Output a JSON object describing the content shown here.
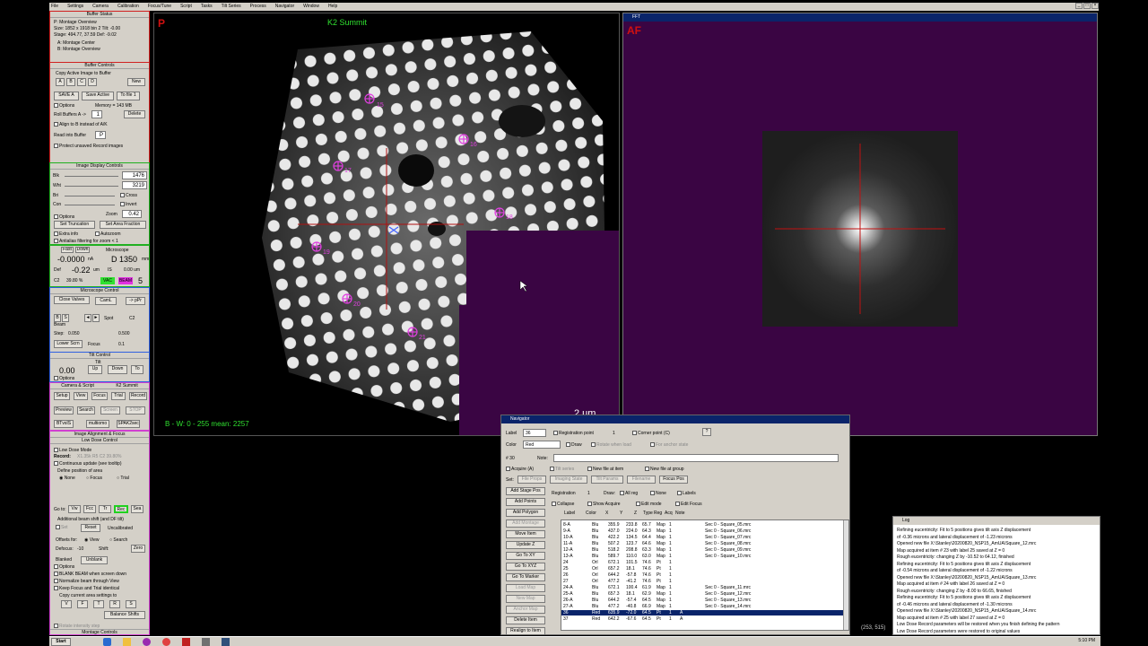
{
  "menu": [
    "File",
    "Settings",
    "Camera",
    "Calibration",
    "Focus/Tune",
    "Script",
    "Tasks",
    "Tilt Series",
    "Process",
    "Navigator",
    "Window",
    "Help"
  ],
  "buffer_status": {
    "title": "Buffer Status",
    "lines": [
      "P: Montage Overview",
      "Size: 1852 x 1918  bin 2    Tilt: -0.00",
      "Stage: 494.77, 37.59      Def: -9.02",
      "A: Montage Center",
      "B: Montage Overview"
    ]
  },
  "buffer_controls": {
    "title": "Buffer Controls",
    "copy_label": "Copy Active Image to Buffer",
    "buffers": [
      "A",
      "B",
      "C",
      "D"
    ],
    "new_label": "New",
    "save_a": "SAVE A",
    "save_active": "Save Active",
    "to_file": "To file 1",
    "options": "Options",
    "memory": "Memory = 143 MB",
    "roll_label": "Roll Buffers A ->",
    "roll_value": "1",
    "delete": "Delete",
    "align": "Align to B instead of A/K",
    "read_label": "Read into Buffer",
    "read_value": "P",
    "protect": "Protect unsaved Record images"
  },
  "image_display": {
    "title": "Image Display Controls",
    "blk_label": "Blk",
    "blk": "1476",
    "wht_label": "Wht",
    "wht": "3219",
    "bri": "Bri",
    "con": "Con",
    "cross": "Cross",
    "invert": "Invert",
    "zoom_label": "Zoom",
    "zoom": "0.42",
    "options": "Options",
    "set_truncation": "Set Truncation",
    "set_area_fraction": "Set Area Fraction",
    "extra_info": "Extra info",
    "autozoom": "Autozoom",
    "antialias": "Antialias filtering for zoom < 1"
  },
  "microscope": {
    "tabs": [
      "Fast",
      "Down"
    ],
    "title": "Microscope",
    "current": "-0.0000",
    "current_unit": "nA",
    "mag": "D  1350",
    "mag_unit": "mm",
    "def_label": "Def",
    "def": "-0.22",
    "def_unit": "um",
    "is_label": "IS",
    "is_value": "0.00 um",
    "c2": "C2",
    "c2_value": "39.80 %",
    "vac": "VAC",
    "beam": "BEAM",
    "spot_num": "5"
  },
  "microscope_control": {
    "title": "Microscope Control",
    "close_valves": "Close Valves",
    "cam_l": "CamL",
    "p_spr": "-> pPr",
    "beam": "Beam",
    "spot": "Spot",
    "c2": "C2",
    "step_label": "Step:",
    "step": "0.050",
    "step2": "0.500",
    "lower_scrn": "Lower Scrn",
    "focus": "Focus",
    "focus_val": "0.1"
  },
  "tilt": {
    "title": "Tilt Control",
    "value": "0.00",
    "up": "Up",
    "down": "Down",
    "to": "To",
    "tilt_label": "Tilt",
    "options": "Options"
  },
  "camera": {
    "title": "Camera & Script",
    "camera_name": "K2 Summit",
    "buttons1": [
      "Setup",
      "View",
      "Focus",
      "Trial",
      "Record"
    ],
    "buttons2": [
      "Preview",
      "Search",
      "Screen",
      "STOP"
    ],
    "script": [
      "BTvsIS",
      "multiomo",
      "SPAK2sec"
    ]
  },
  "low_dose": {
    "title": "Low Dose Control",
    "ila_title": "Image Alignment & Focus",
    "low_dose_mode": "Low Dose Mode",
    "record_label": "Record:",
    "record_info": "X1.35k  R5  C2 39.80%",
    "continuous": "Continuous update (see tooltip)",
    "define": "Define position of area",
    "none": "None",
    "focus": "Focus",
    "trial": "Trial",
    "goto_label": "Go to:",
    "goto": [
      "Vw",
      "Fcc",
      "Tr",
      "Rec",
      "Sea"
    ],
    "additional": "Additional beam shift (and DF tilt)",
    "set": "Set",
    "reset": "Reset",
    "uncalibrated": "Uncalibrated",
    "offsets": "Offsets for:",
    "view": "View",
    "search": "Search",
    "defocus_label": "Defocus:",
    "defocus": "-10",
    "shift": "Shift:",
    "zero": "Zero",
    "blanked": "Blanked",
    "unblank": "Unblank",
    "options": "Options",
    "blank_beam": "BLANK BEAM when screen down",
    "normalize": "Normalize beam through View",
    "keep_focus": "Keep Focus and Trial identical",
    "copy_label": "Copy current area settings to",
    "copy": [
      "V",
      "F",
      "T",
      "R",
      "S"
    ],
    "balance": "Balance Shifts",
    "rotate": "Rotate intensity step",
    "montage_title": "Montage Controls"
  },
  "image_window": {
    "label_p": "P",
    "camera": "K2 Summit",
    "status": "B - W: 0 - 255  mean: 2257",
    "scale": "2 um",
    "markers": [
      "15",
      "16",
      "17",
      "18",
      "19",
      "20",
      "21",
      "22",
      "23"
    ]
  },
  "fft_window": {
    "title": "FFT",
    "label": "AF"
  },
  "navigator": {
    "title": "Navigator",
    "label_label": "Label",
    "label_value": "36",
    "registration_point": "Registration point",
    "reg_value": "1",
    "corner_point": "Corner point (C)",
    "help": "?",
    "color_label": "Color",
    "color_value": "Red",
    "draw": "Draw",
    "rotate_when_load": "Rotate when load",
    "for_anchor": "For anchor state",
    "item_num": "# 30",
    "note_label": "Note:",
    "acquire": "Acquire (A)",
    "tilt_series": "Tilt series",
    "new_file_item": "New file at item",
    "new_file_group": "New file at group",
    "set_label": "Set:",
    "set_buttons": [
      "File Props",
      "Imaging State",
      "Tilt Params",
      "Filename"
    ],
    "focus_pos": "Focus Pos",
    "add_stage_pos": "Add Stage Pos",
    "registration_label": "Registration",
    "registration_value": "1",
    "draw2": "Draw:",
    "all_reg": "All reg",
    "none": "None",
    "labels": "Labels",
    "add_points": "Add Points",
    "collapse": "Collapse",
    "show_acquire": "Show Acquire",
    "edit_mode": "Edit mode",
    "edit_focus": "Edit Focus",
    "add_polygon": "Add Polygon",
    "columns": [
      "Label",
      "Color",
      "X",
      "Y",
      "Z",
      "Type",
      "Reg",
      "Acq",
      "Note"
    ],
    "side_buttons": [
      "Add Montage",
      "Move Item",
      "Update Z",
      "Go To XY",
      "Go To XYZ",
      "Go To Marker",
      "Load Map",
      "New Map",
      "Anchor Map",
      "Delete Item",
      "Realign to Item"
    ],
    "rows": [
      [
        "8-A",
        "Blu",
        "355.9",
        "233.8",
        "65.7",
        "Map",
        "1",
        "",
        "Sec 0 - Square_05.mrc"
      ],
      [
        "9-A",
        "Blu",
        "437.0",
        "224.0",
        "64.3",
        "Map",
        "1",
        "",
        "Sec 0 - Square_06.mrc"
      ],
      [
        "10-A",
        "Blu",
        "422.2",
        "134.5",
        "64.4",
        "Map",
        "1",
        "",
        "Sec 0 - Square_07.mrc"
      ],
      [
        "11-A",
        "Blu",
        "507.2",
        "123.7",
        "64.6",
        "Map",
        "1",
        "",
        "Sec 0 - Square_08.mrc"
      ],
      [
        "12-A",
        "Blu",
        "518.2",
        "208.8",
        "63.3",
        "Map",
        "1",
        "",
        "Sec 0 - Square_09.mrc"
      ],
      [
        "13-A",
        "Blu",
        "589.7",
        "110.0",
        "63.0",
        "Map",
        "1",
        "",
        "Sec 0 - Square_10.mrc"
      ],
      [
        "24",
        "Orl",
        "672.1",
        "101.5",
        "74.6",
        "Pt",
        "1",
        "",
        ""
      ],
      [
        "25",
        "Orl",
        "657.2",
        "18.1",
        "74.6",
        "Pt",
        "1",
        "",
        ""
      ],
      [
        "26",
        "Orl",
        "644.2",
        "-57.8",
        "74.6",
        "Pt",
        "1",
        "",
        ""
      ],
      [
        "27",
        "Orl",
        "477.2",
        "-41.2",
        "74.6",
        "Pt",
        "1",
        "",
        ""
      ],
      [
        "24-A",
        "Blu",
        "672.1",
        "100.4",
        "61.9",
        "Map",
        "1",
        "",
        "Sec 0 - Square_11.mrc"
      ],
      [
        "25-A",
        "Blu",
        "657.3",
        "18.1",
        "62.9",
        "Map",
        "1",
        "",
        "Sec 0 - Square_12.mrc"
      ],
      [
        "26-A",
        "Blu",
        "644.2",
        "-57.4",
        "64.5",
        "Map",
        "1",
        "",
        "Sec 0 - Square_13.mrc"
      ],
      [
        "27-A",
        "Blu",
        "477.2",
        "-40.8",
        "66.9",
        "Map",
        "1",
        "",
        "Sec 0 - Square_14.mrc"
      ],
      [
        "36",
        "Red",
        "635.9",
        "-72.0",
        "64.5",
        "Pt",
        "1",
        "A",
        ""
      ],
      [
        "37",
        "Red",
        "642.2",
        "-67.6",
        "64.5",
        "Pt",
        "1",
        "A",
        ""
      ]
    ],
    "selected_row": 14
  },
  "log": {
    "title": "Log",
    "lines": [
      "Refining eucentricity: Fit to 5 positions gives tilt axis Z displacement",
      "  of -0.36 microns and lateral displacement of -1.23 microns",
      "Opened new file X:\\Stanley\\20200820_NSP15_AmUA\\Square_12.mrc",
      "Map acquired at item # 23 with label 25 saved at Z = 0",
      "Rough eucentricity: changing Z by -10.52 to 64.12, finished",
      "Refining eucentricity: Fit to 5 positions gives tilt axis Z displacement",
      "  of -0.54 microns and lateral displacement of -1.22 microns",
      "Opened new file X:\\Stanley\\20200820_NSP15_AmUA\\Square_13.mrc",
      "Map acquired at item # 24 with label 26 saved at Z = 0",
      "Rough eucentricity: changing Z by -8.00 to 66.65, finished",
      "Refining eucentricity: Fit to 5 positions gives tilt axis Z displacement",
      "  of -0.46 microns and lateral displacement of -1.30 microns",
      "Opened new file X:\\Stanley\\20200820_NSP15_AmUA\\Square_14.mrc",
      "Map acquired at item # 25 with label 27 saved at Z = 0",
      "Low Dose Record parameters will be restored when you finish defining the pattern",
      "Low Dose Record parameters were restored to original values"
    ]
  },
  "statusbar": {
    "coords": "(253, 515)",
    "start": "Start",
    "clock": "5:10 PM"
  }
}
